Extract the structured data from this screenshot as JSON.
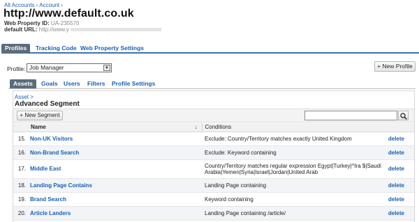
{
  "breadcrumb": {
    "items": [
      "All Accounts",
      "Account"
    ]
  },
  "site_title": "http://www.default.co.uk",
  "meta": {
    "property_id_label": "Web Property ID:",
    "property_id_value": "UA-235570",
    "default_url_label": "default URL:",
    "default_url_value": "http://www.y"
  },
  "primary_tabs": [
    "Profiles",
    "Tracking Code",
    "Web Property Settings"
  ],
  "profile": {
    "label": "Profile:",
    "selected": "Job Manager",
    "new_profile_button": "+ New Profile"
  },
  "secondary_tabs": [
    "Assets",
    "Goals",
    "Users",
    "Filters",
    "Profile Settings"
  ],
  "panel": {
    "asset_link": "Asset >",
    "title": "Advanced Segment",
    "new_segment_button": "+ New Segment",
    "search_placeholder": ""
  },
  "table": {
    "columns": {
      "name": "Name",
      "conditions": "Conditions"
    },
    "rows": [
      {
        "num": "15.",
        "name": "Non-UK Visitors",
        "conditions": "Exclude: Country/Territory matches exactly United Kingdom",
        "action": "delete"
      },
      {
        "num": "16.",
        "name": "Non-Brand Search",
        "conditions": "Exclude: Keyword containing",
        "action": "delete"
      },
      {
        "num": "17.",
        "name": "Middle East",
        "conditions": "Country/Territory matches regular expression Egypt|Turkey|^Ira $|Saudi Arabia|Yemen|Syria|Israel|Jordan|United Arab",
        "action": "delete"
      },
      {
        "num": "18.",
        "name": "Landing Page Contains",
        "conditions": "Landing Page containing",
        "action": "delete"
      },
      {
        "num": "19.",
        "name": "Brand Search",
        "conditions": "Keyword containing",
        "action": "delete"
      },
      {
        "num": "20.",
        "name": "Article Landers",
        "conditions": "Landing Page containing /article/",
        "action": "delete"
      }
    ]
  },
  "colors": {
    "link": "#1a5fb0",
    "active_tab": "#5b6b7d",
    "tab_rule": "#3d6fb3"
  }
}
